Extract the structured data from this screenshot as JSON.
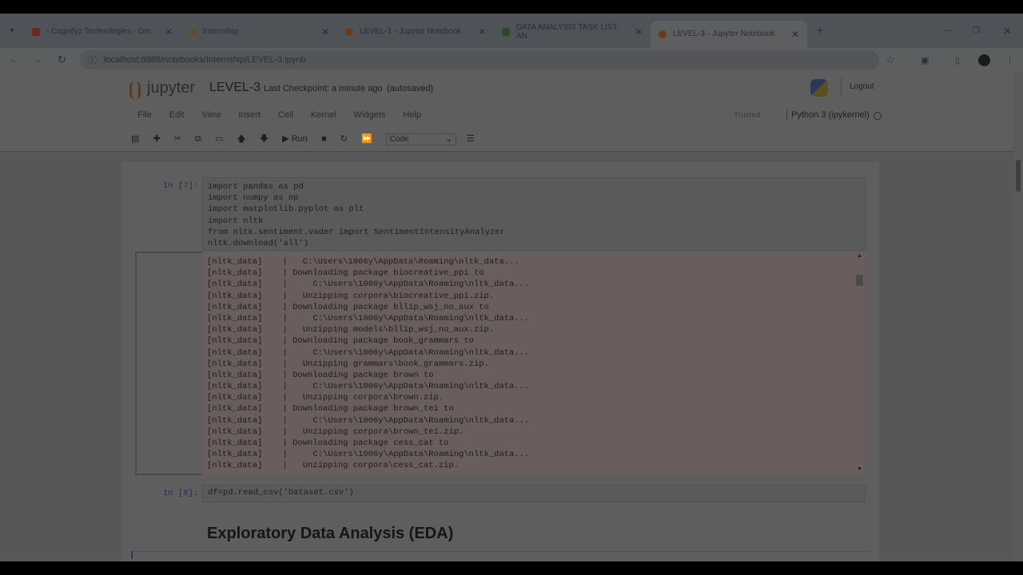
{
  "browser": {
    "tabs": [
      {
        "label": "- Cognifyz Technologies · Gm",
        "color": "#6a2a22"
      },
      {
        "label": "Internship",
        "color": "#5a5030"
      },
      {
        "label": "LEVEL-1 - Jupyter Notebook",
        "color": "#6a3a1a"
      },
      {
        "label": "DATA ANALYSIS TASK LIST AN",
        "color": "#2a4a2a"
      },
      {
        "label": "LEVEL-3 - Jupyter Notebook",
        "color": "#6a3a1a"
      }
    ],
    "new_tab": "+",
    "url": "localhost:8888/notebooks/Internship/LEVEL-3.ipynb"
  },
  "jupyter": {
    "logo": "jupyter",
    "title": "LEVEL-3",
    "checkpoint": "Last Checkpoint: a minute ago",
    "autosaved": "(autosaved)",
    "logout": "Logout",
    "menu": [
      "File",
      "Edit",
      "View",
      "Insert",
      "Cell",
      "Kernel",
      "Widgets",
      "Help"
    ],
    "trusted": "Trusted",
    "kernel": "Python 3 (ipykernel)",
    "run": "Run",
    "cell_type": "Code"
  },
  "cells": [
    {
      "prompt": "In [7]:",
      "code": "import pandas as pd\nimport numpy as np\nimport matplotlib.pyplot as plt\nimport nltk\nfrom nltk.sentiment.vader import SentimentIntensityAnalyzer\nnltk.download('all')",
      "output": [
        "[nltk_data]    |   C:\\Users\\1006y\\AppData\\Roaming\\nltk_data...",
        "[nltk_data]    | Downloading package biocreative_ppi to",
        "[nltk_data]    |     C:\\Users\\1006y\\AppData\\Roaming\\nltk_data...",
        "[nltk_data]    |   Unzipping corpora\\biocreative_ppi.zip.",
        "[nltk_data]    | Downloading package bllip_wsj_no_aux to",
        "[nltk_data]    |     C:\\Users\\1006y\\AppData\\Roaming\\nltk_data...",
        "[nltk_data]    |   Unzipping models\\bllip_wsj_no_aux.zip.",
        "[nltk_data]    | Downloading package book_grammars to",
        "[nltk_data]    |     C:\\Users\\1006y\\AppData\\Roaming\\nltk_data...",
        "[nltk_data]    |   Unzipping grammars\\book_grammars.zip.",
        "[nltk_data]    | Downloading package brown to",
        "[nltk_data]    |     C:\\Users\\1006y\\AppData\\Roaming\\nltk_data...",
        "[nltk_data]    |   Unzipping corpora\\brown.zip.",
        "[nltk_data]    | Downloading package brown_tei to",
        "[nltk_data]    |     C:\\Users\\1006y\\AppData\\Roaming\\nltk_data...",
        "[nltk_data]    |   Unzipping corpora\\brown_tei.zip.",
        "[nltk_data]    | Downloading package cess_cat to",
        "[nltk_data]    |     C:\\Users\\1006y\\AppData\\Roaming\\nltk_data...",
        "[nltk_data]    |   Unzipping corpora\\cess_cat.zip."
      ]
    },
    {
      "prompt": "In [8]:",
      "code": "df=pd.read_csv('Dataset.csv')"
    }
  ],
  "markdown_heading": "Exploratory Data Analysis (EDA)"
}
